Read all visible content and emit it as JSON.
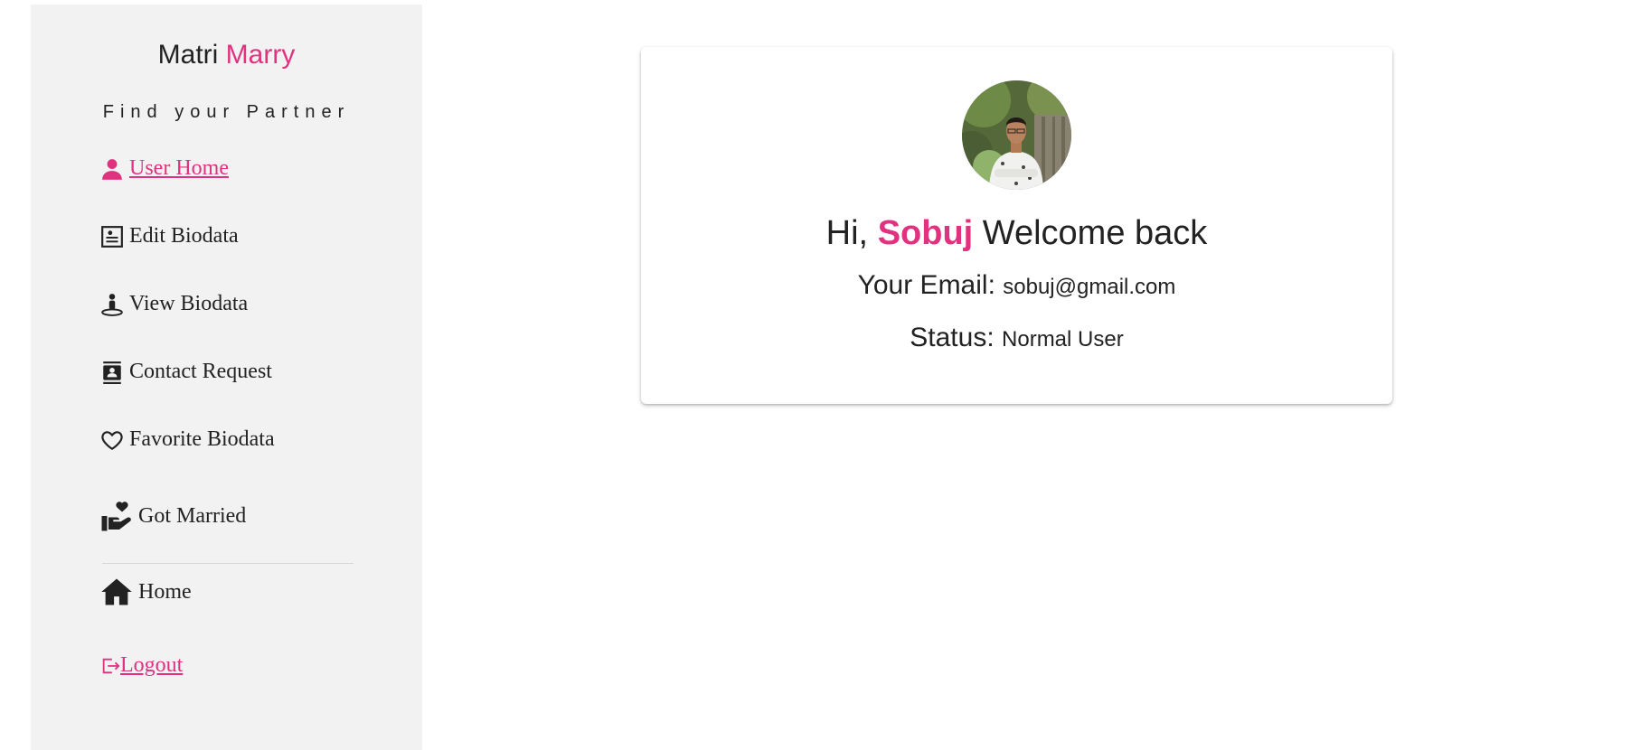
{
  "sidebar": {
    "brand": {
      "part1": "Matri",
      "part2": "Marry"
    },
    "tagline": "Find your Partner",
    "items": [
      {
        "label": "User Home",
        "icon": "user-icon",
        "active": true
      },
      {
        "label": "Edit Biodata",
        "icon": "id-card-icon"
      },
      {
        "label": "View Biodata",
        "icon": "person-pin-icon"
      },
      {
        "label": "Contact Request",
        "icon": "contact-book-icon"
      },
      {
        "label": "Favorite Biodata",
        "icon": "heart-outline-icon"
      },
      {
        "label": "Got Married",
        "icon": "hand-heart-icon"
      }
    ],
    "bottom_items": [
      {
        "label": "Home",
        "icon": "home-icon"
      },
      {
        "label": "Logout",
        "icon": "logout-icon"
      }
    ]
  },
  "profile": {
    "greeting_prefix": "Hi,",
    "name": "Sobuj",
    "greeting_suffix": "Welcome back",
    "email_label": "Your Email:",
    "email": "sobuj@gmail.com",
    "status_label": "Status:",
    "status": "Normal User"
  },
  "colors": {
    "accent": "#e0327f",
    "sidebar_bg": "#f2f2f2",
    "text": "#222222"
  }
}
